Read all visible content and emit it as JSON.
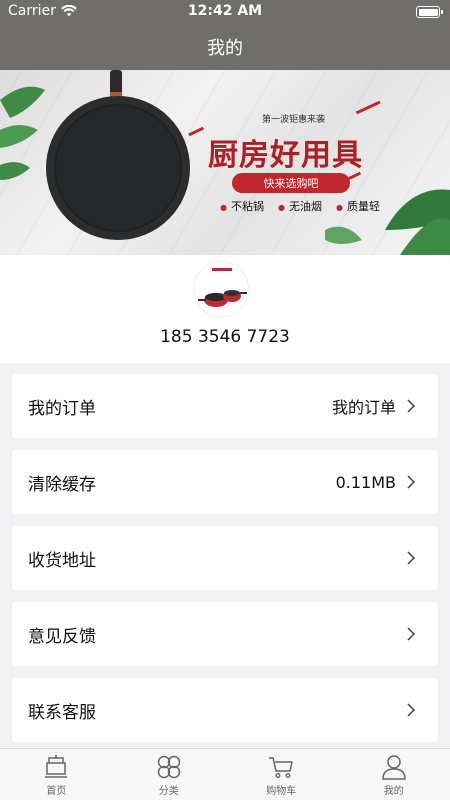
{
  "status_bar": {
    "carrier": "Carrier",
    "time": "12:42 AM"
  },
  "nav": {
    "title": "我的"
  },
  "banner": {
    "small_text": "第一波钜惠来袭",
    "title": "厨房好用具",
    "pill": "快来选购吧",
    "features": [
      "不粘锅",
      "无油烟",
      "质量轻"
    ]
  },
  "profile": {
    "phone": "185 3546 7723"
  },
  "menu": [
    {
      "label": "我的订单",
      "value": "我的订单"
    },
    {
      "label": "清除缓存",
      "value": "0.11MB"
    },
    {
      "label": "收货地址",
      "value": ""
    },
    {
      "label": "意见反馈",
      "value": ""
    },
    {
      "label": "联系客服",
      "value": ""
    }
  ],
  "tabs": [
    {
      "label": "首页",
      "icon": "home-icon"
    },
    {
      "label": "分类",
      "icon": "category-icon"
    },
    {
      "label": "购物车",
      "icon": "cart-icon"
    },
    {
      "label": "我的",
      "icon": "profile-icon"
    }
  ],
  "colors": {
    "nav_bg": "#6f6e6a",
    "accent_red": "#c1272d",
    "page_bg": "#f1f1f4"
  }
}
